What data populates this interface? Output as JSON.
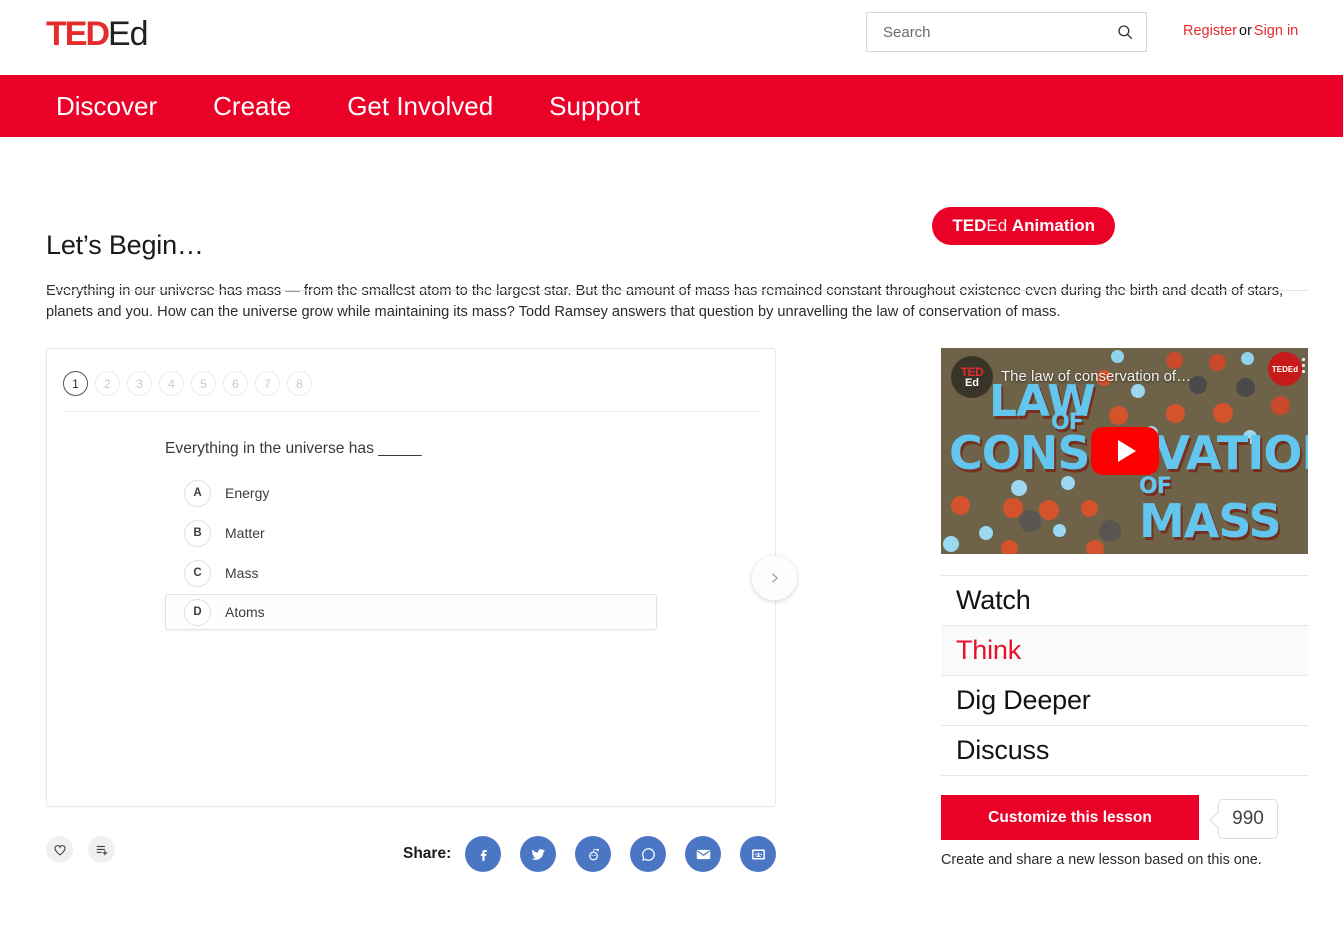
{
  "header": {
    "logo_ted": "TED",
    "logo_ed": "Ed",
    "search": {
      "placeholder": "Search",
      "value": "",
      "icon": "search-icon"
    },
    "auth": {
      "register": "Register",
      "separator": "or",
      "signin": "Sign in"
    }
  },
  "nav": {
    "items": [
      {
        "label": "Discover"
      },
      {
        "label": "Create"
      },
      {
        "label": "Get Involved"
      },
      {
        "label": "Support"
      }
    ]
  },
  "badge": {
    "part1": "TED",
    "part2": "Ed",
    "part3": "Animation"
  },
  "intro": {
    "heading": "Let’s Begin…",
    "body": "Everything in our universe has mass — from the smallest atom to the largest star. But the amount of mass has remained constant throughout existence even during the birth and death of stars, planets and you. How can the universe grow while maintaining its mass? Todd Ramsey answers that question by unravelling the law of conservation of mass."
  },
  "quiz": {
    "question_numbers": [
      "1",
      "2",
      "3",
      "4",
      "5",
      "6",
      "7",
      "8"
    ],
    "active_question": "1",
    "question_text": "Everything in the universe has _____",
    "answers": [
      {
        "letter": "A",
        "text": "Energy",
        "selected": false
      },
      {
        "letter": "B",
        "text": "Matter",
        "selected": false
      },
      {
        "letter": "C",
        "text": "Mass",
        "selected": false
      },
      {
        "letter": "D",
        "text": "Atoms",
        "selected": true
      }
    ],
    "next_icon": "chevron-right-icon"
  },
  "actions": {
    "favorite_icon": "heart-icon",
    "playlist_icon": "add-to-playlist-icon",
    "share_label": "Share:",
    "share_buttons": [
      {
        "name": "facebook-icon",
        "label": "Facebook"
      },
      {
        "name": "twitter-icon",
        "label": "Twitter"
      },
      {
        "name": "reddit-icon",
        "label": "Reddit"
      },
      {
        "name": "whatsapp-icon",
        "label": "WhatsApp"
      },
      {
        "name": "email-icon",
        "label": "Email"
      },
      {
        "name": "google-classroom-icon",
        "label": "Google Classroom"
      }
    ],
    "share_color": "#4a76c4"
  },
  "video": {
    "title": "The law of conservation of…",
    "channel_logo_top": "TED",
    "channel_logo_bottom": "Ed",
    "watermark": "TEDEd",
    "poster_words": [
      "LAW",
      "OF",
      "CONSERVATION",
      "OF",
      "MASS"
    ],
    "poster_bg": "#6e6248",
    "poster_text_color": "#62c6ee",
    "play_icon": "youtube-play-icon"
  },
  "tabs": [
    {
      "label": "Watch",
      "active": false
    },
    {
      "label": "Think",
      "active": true
    },
    {
      "label": "Dig Deeper",
      "active": false
    },
    {
      "label": "Discuss",
      "active": false
    }
  ],
  "customize": {
    "button_label": "Customize this lesson",
    "count": "990",
    "description": "Create and share a new lesson based on this one."
  },
  "colors": {
    "brand_red": "#eb0028",
    "accent_red": "#e8112d"
  }
}
